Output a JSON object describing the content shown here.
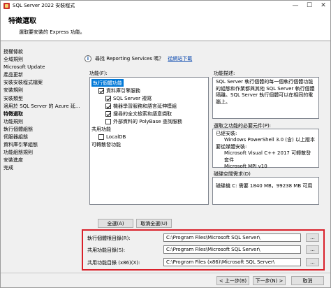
{
  "window": {
    "title": "SQL Server 2022 安裝程式",
    "minimize": "—",
    "maximize": "☐",
    "close": "✕"
  },
  "header": {
    "title": "特徵選取",
    "description": "選取要安裝的 Express 功能。"
  },
  "nav": [
    "授權條款",
    "全域規則",
    "Microsoft Update",
    "產品更新",
    "安裝安裝程式檔案",
    "安裝規則",
    "安裝類型",
    "適用於 SQL Server 的 Azure 延...",
    "特徵選取",
    "功能規則",
    "執行個體組態",
    "伺服器組態",
    "資料庫引擎組態",
    "功能組態規則",
    "安裝進度",
    "完成"
  ],
  "nav_active_index": 8,
  "help": {
    "text": "尋找 Reporting Services 嗎？",
    "link": "從網站下載"
  },
  "labels": {
    "features": "功能(F):",
    "description": "功能描述:",
    "prereq": "選取之功能的必要元件(P):",
    "disk": "磁碟空間需求(D)"
  },
  "features": [
    {
      "label": "執行個體功能",
      "checkbox": false,
      "checked": false,
      "selected": true,
      "indent": 0
    },
    {
      "label": "資料庫引擎服務",
      "checkbox": true,
      "checked": true,
      "selected": false,
      "indent": 1
    },
    {
      "label": "SQL Server 複寫",
      "checkbox": true,
      "checked": true,
      "selected": false,
      "indent": 2
    },
    {
      "label": "機器學習服務和語言延伸模組",
      "checkbox": true,
      "checked": true,
      "selected": false,
      "indent": 2
    },
    {
      "label": "搜尋的全文檢索和語意擷取",
      "checkbox": true,
      "checked": true,
      "selected": false,
      "indent": 2
    },
    {
      "label": "外部資料的 PolyBase 查詢服務",
      "checkbox": true,
      "checked": false,
      "selected": false,
      "indent": 2
    },
    {
      "label": "共用功能",
      "checkbox": false,
      "checked": false,
      "selected": false,
      "indent": 0
    },
    {
      "label": "LocalDB",
      "checkbox": true,
      "checked": false,
      "selected": false,
      "indent": 1
    },
    {
      "label": "可轉散發功能",
      "checkbox": false,
      "checked": false,
      "selected": false,
      "indent": 0
    }
  ],
  "description_text": "SQL Server 執行個體的每一個執行個體功能的組態和作業都與其他 SQL Server 執行個體隔離。SQL Server 執行個體可以在相同的電腦上。",
  "prereq": {
    "installed_header": "已經安裝:",
    "installed": [
      "Windows PowerShell 3.0 (含) 以上版本"
    ],
    "to_install_header": "要從媒體安裝:",
    "to_install": [
      "Microsoft Visual C++ 2017 可轉散發套件",
      "Microsoft MPI v10"
    ]
  },
  "disk_text": "磁碟機 C: 需要 1840 MB，99238 MB 可用",
  "buttons": {
    "select_all": "全選(A)",
    "unselect_all": "取消全選(U)",
    "back": "< 上一步(B)",
    "next": "下一步(N) >",
    "cancel": "取消"
  },
  "directories": [
    {
      "label": "執行個體根目錄(R):",
      "value": "C:\\Program Files\\Microsoft SQL Server\\",
      "browse": "..."
    },
    {
      "label": "共用功能目錄(S):",
      "value": "C:\\Program Files\\Microsoft SQL Server\\",
      "browse": "..."
    },
    {
      "label": "共用功能目錄 (x86)(X):",
      "value": "C:\\Program Files (x86)\\Microsoft SQL Server\\",
      "browse": "..."
    }
  ]
}
